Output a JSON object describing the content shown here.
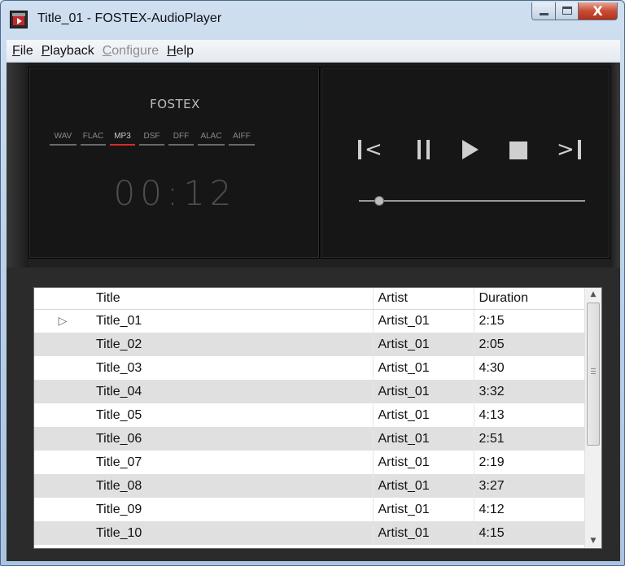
{
  "window": {
    "title": "Title_01 - FOSTEX-AudioPlayer",
    "close_glyph": "X"
  },
  "menu": {
    "items": [
      {
        "mnemonic": "F",
        "rest": "ile",
        "enabled": true
      },
      {
        "mnemonic": "P",
        "rest": "layback",
        "enabled": true
      },
      {
        "mnemonic": "C",
        "rest": "onfigure",
        "enabled": false
      },
      {
        "mnemonic": "H",
        "rest": "elp",
        "enabled": true
      }
    ]
  },
  "player": {
    "brand": "FOSTEX",
    "formats": [
      "WAV",
      "FLAC",
      "MP3",
      "DSF",
      "DFF",
      "ALAC",
      "AIFF"
    ],
    "active_format": "MP3",
    "time": "00:12",
    "seek_fraction": 0.09,
    "icons": {
      "prev": "skip-previous-icon",
      "pause": "pause-icon",
      "play": "play-icon",
      "stop": "stop-icon",
      "next": "skip-next-icon"
    },
    "glyphs": {
      "prev_chev": "<",
      "next_chev": ">"
    },
    "colors": {
      "accent": "#d42b2b",
      "panel": "#161616",
      "control": "#cfcfcf"
    }
  },
  "playlist": {
    "columns": {
      "title": "Title",
      "artist": "Artist",
      "duration": "Duration"
    },
    "playing_marker": "▷",
    "rows": [
      {
        "title": "Title_01",
        "artist": "Artist_01",
        "duration": "2:15",
        "playing": true
      },
      {
        "title": "Title_02",
        "artist": "Artist_01",
        "duration": "2:05",
        "playing": false
      },
      {
        "title": "Title_03",
        "artist": "Artist_01",
        "duration": "4:30",
        "playing": false
      },
      {
        "title": "Title_04",
        "artist": "Artist_01",
        "duration": "3:32",
        "playing": false
      },
      {
        "title": "Title_05",
        "artist": "Artist_01",
        "duration": "4:13",
        "playing": false
      },
      {
        "title": "Title_06",
        "artist": "Artist_01",
        "duration": "2:51",
        "playing": false
      },
      {
        "title": "Title_07",
        "artist": "Artist_01",
        "duration": "2:19",
        "playing": false
      },
      {
        "title": "Title_08",
        "artist": "Artist_01",
        "duration": "3:27",
        "playing": false
      },
      {
        "title": "Title_09",
        "artist": "Artist_01",
        "duration": "4:12",
        "playing": false
      },
      {
        "title": "Title_10",
        "artist": "Artist_01",
        "duration": "4:15",
        "playing": false
      }
    ],
    "scroll": {
      "up_glyph": "▲",
      "down_glyph": "▼"
    }
  }
}
